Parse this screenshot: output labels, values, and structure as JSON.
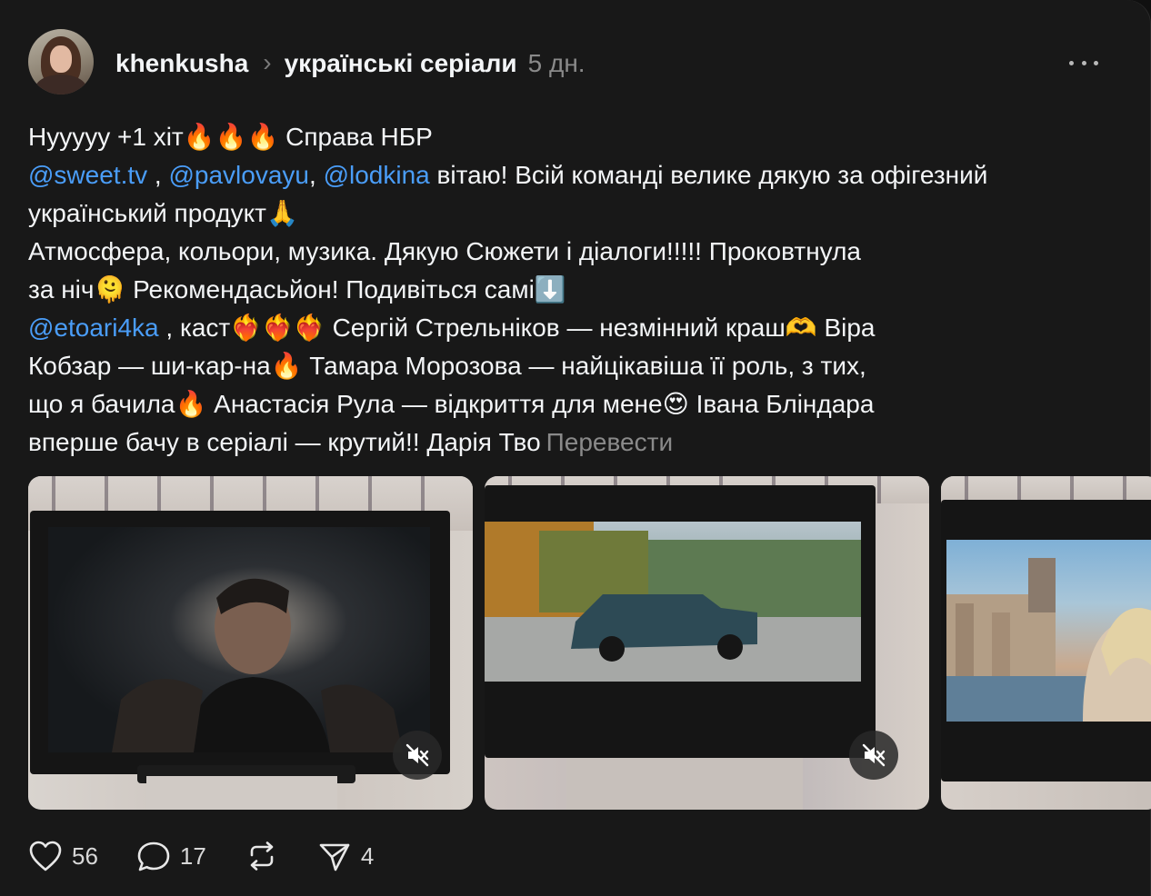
{
  "post": {
    "username": "khenkusha",
    "topic": "українські серіали",
    "time": "5 дн.",
    "more_icon": "more-horizontal-icon",
    "text": {
      "l1": "Нууууу +1 хіт🔥🔥🔥 Справа НБР",
      "l2_m1": "@sweet.tv",
      "l2_s1": " , ",
      "l2_m2": "@pavlovayu",
      "l2_s2": ", ",
      "l2_m3": "@lodkina",
      "l2_rest": " вітаю! Всій команді велике дякую за офігезний",
      "l3": "український продукт🙏",
      "l4": "Атмосфера, кольори, музика. Дякую Сюжети і діалоги!!!!! Проковтнула",
      "l5": "за ніч🫠 Рекомендасьйон! Подивіться самі⬇️",
      "l6_m": "@etoari4ka",
      "l6_rest": " , каст❤️‍🔥❤️‍🔥❤️‍🔥 Сергій Стрельніков — незмінний краш🫶 Віра",
      "l7": "Кобзар — ши-кар-на🔥 Тамара Морозова — найцікавіша її роль, з тих,",
      "l8": "що я бачила🔥 Анастасія Рула — відкриття для мене😍 Івана Бліндара",
      "l9": "вперше бачу в серіалі — крутий!! Дарія Тво",
      "translate": "Перевести"
    },
    "media": [
      {
        "kind": "video",
        "muted": true,
        "icon": "mute-icon"
      },
      {
        "kind": "video",
        "muted": true,
        "icon": "mute-icon"
      },
      {
        "kind": "video",
        "muted": false
      }
    ],
    "actions": {
      "likes": "56",
      "replies": "17",
      "shares": "4"
    }
  }
}
